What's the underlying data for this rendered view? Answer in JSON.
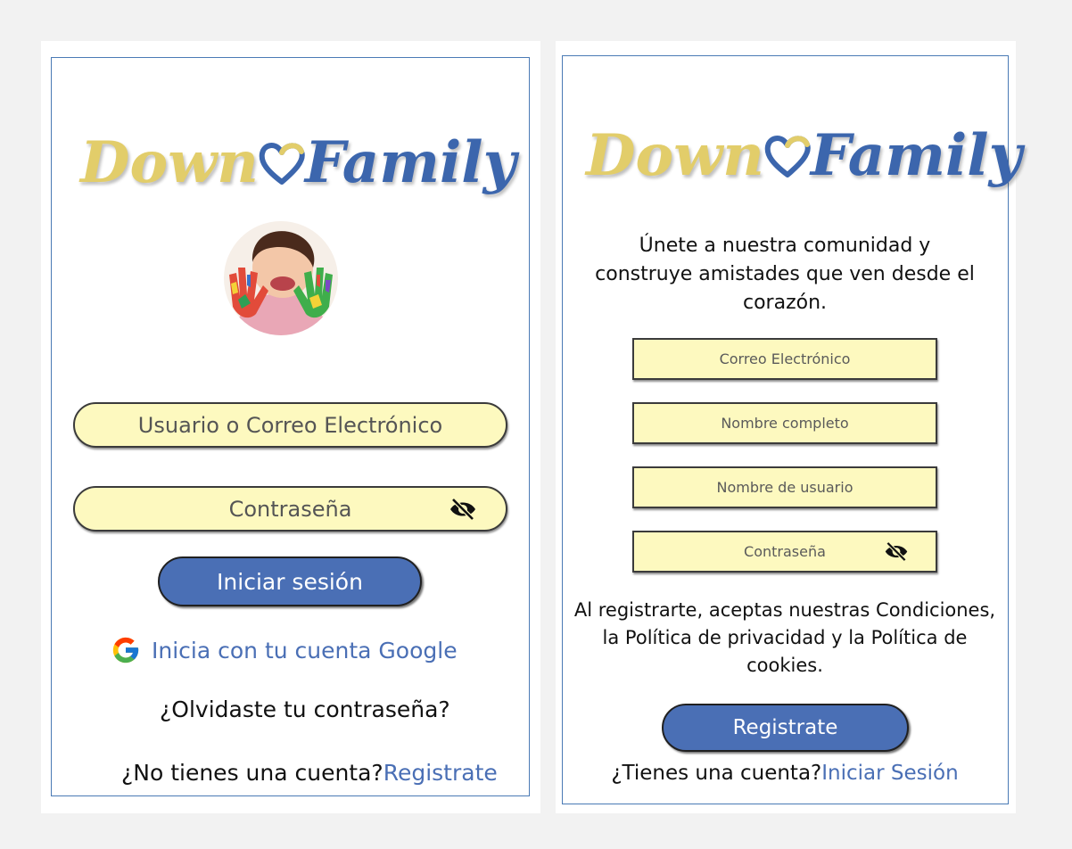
{
  "login": {
    "logo_part1": "Down",
    "logo_part2": "Family",
    "username_placeholder": "Usuario o Correo Electrónico",
    "password_placeholder": "Contraseña",
    "submit_label": "Iniciar sesión",
    "google_label": "Inicia con tu cuenta Google",
    "forgot_label": "¿Olvidaste tu contraseña?",
    "no_account_text": "¿No tienes una cuenta?",
    "register_link": "Registrate"
  },
  "register": {
    "logo_part1": "Down",
    "logo_part2": "Family",
    "intro_line1": "Únete a nuestra comunidad y",
    "intro_line2": "construye amistades que ven desde el",
    "intro_line3": "corazón.",
    "email_placeholder": "Correo Electrónico",
    "fullname_placeholder": "Nombre completo",
    "username_placeholder": "Nombre de usuario",
    "password_placeholder": "Contraseña",
    "terms_line1": "Al registrarte, aceptas nuestras Condiciones,",
    "terms_line2": "la Política de privacidad y la Política de",
    "terms_line3": "cookies.",
    "submit_label": "Registrate",
    "have_account_text": "¿Tienes una cuenta?",
    "login_link": "Iniciar Sesión"
  },
  "colors": {
    "accent_blue": "#4a6fb5",
    "input_yellow": "#fdf9bf",
    "logo_gold": "#e2cd6a",
    "frame_blue": "#4a7ab5"
  },
  "icons": {
    "password_toggle": "eye-slash-icon",
    "google": "google-icon",
    "logo_heart": "heart-icon"
  }
}
